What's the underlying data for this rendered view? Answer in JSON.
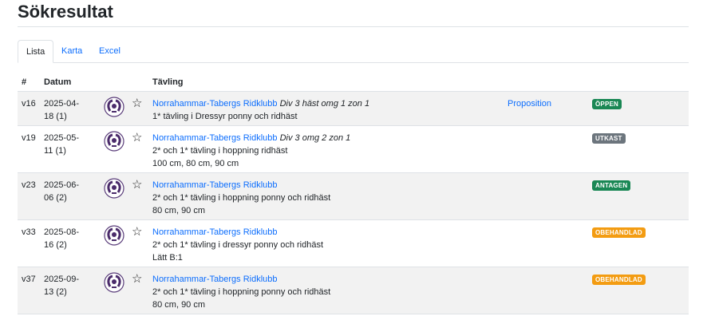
{
  "page_title": "Sökresultat",
  "tabs": [
    {
      "label": "Lista",
      "active": true
    },
    {
      "label": "Karta",
      "active": false
    },
    {
      "label": "Excel",
      "active": false
    }
  ],
  "table": {
    "headers": [
      "#",
      "Datum",
      "Tävling"
    ],
    "rows": [
      {
        "week": "v16",
        "date": "2025-04-18 (1)",
        "club": "Norrahammar-Tabergs Ridklubb",
        "division": "Div 3 häst omg 1 zon 1",
        "lines": [
          "1* tävling i Dressyr ponny och ridhäst"
        ],
        "proposition": "Proposition",
        "status": "ÖPPEN",
        "status_color": "#198754"
      },
      {
        "week": "v19",
        "date": "2025-05-11 (1)",
        "club": "Norrahammar-Tabergs Ridklubb",
        "division": "Div 3 omg 2 zon 1",
        "lines": [
          "2* och 1* tävling i hoppning ridhäst",
          "100 cm, 80 cm, 90 cm"
        ],
        "proposition": "",
        "status": "UTKAST",
        "status_color": "#6c757d"
      },
      {
        "week": "v23",
        "date": "2025-06-06 (2)",
        "club": "Norrahammar-Tabergs Ridklubb",
        "division": "",
        "lines": [
          "2* och 1* tävling i hoppning ponny och ridhäst",
          "80 cm, 90 cm"
        ],
        "proposition": "",
        "status": "ANTAGEN",
        "status_color": "#198754"
      },
      {
        "week": "v33",
        "date": "2025-08-16 (2)",
        "club": "Norrahammar-Tabergs Ridklubb",
        "division": "",
        "lines": [
          "2* och 1* tävling i dressyr ponny och ridhäst",
          "Lätt B:1"
        ],
        "proposition": "",
        "status": "OBEHANDLAD",
        "status_color": "#f39c12"
      },
      {
        "week": "v37",
        "date": "2025-09-13 (2)",
        "club": "Norrahammar-Tabergs Ridklubb",
        "division": "",
        "lines": [
          "2* och 1* tävling i hoppning ponny och ridhäst",
          "80 cm, 90 cm"
        ],
        "proposition": "",
        "status": "OBEHANDLAD",
        "status_color": "#f39c12"
      }
    ]
  },
  "icons": {
    "favorite": "star-outline-icon",
    "club_logo": "horseshoe-logo-icon"
  }
}
